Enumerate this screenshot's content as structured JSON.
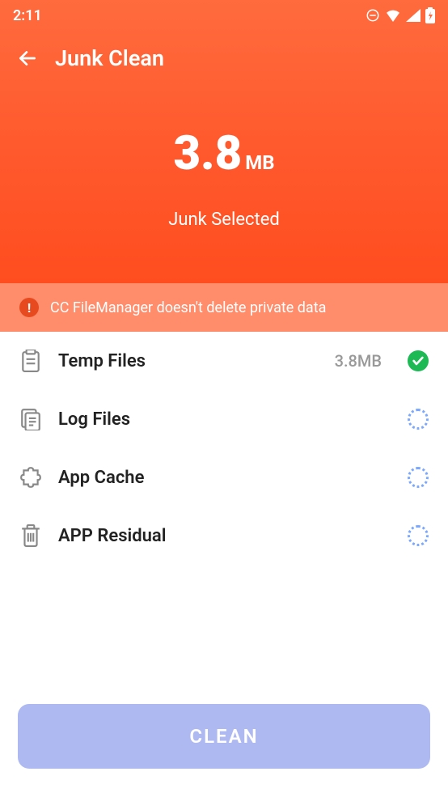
{
  "status_bar": {
    "time": "2:11"
  },
  "header": {
    "title": "Junk Clean",
    "size_value": "3.8",
    "size_unit": "MB",
    "subtitle": "Junk Selected"
  },
  "notice": {
    "text": "CC FileManager doesn't delete private data"
  },
  "categories": [
    {
      "label": "Temp Files",
      "size": "3.8MB",
      "state": "checked"
    },
    {
      "label": "Log Files",
      "size": "",
      "state": "loading"
    },
    {
      "label": "App Cache",
      "size": "",
      "state": "loading"
    },
    {
      "label": "APP Residual",
      "size": "",
      "state": "loading"
    }
  ],
  "button": {
    "clean_label": "CLEAN"
  }
}
